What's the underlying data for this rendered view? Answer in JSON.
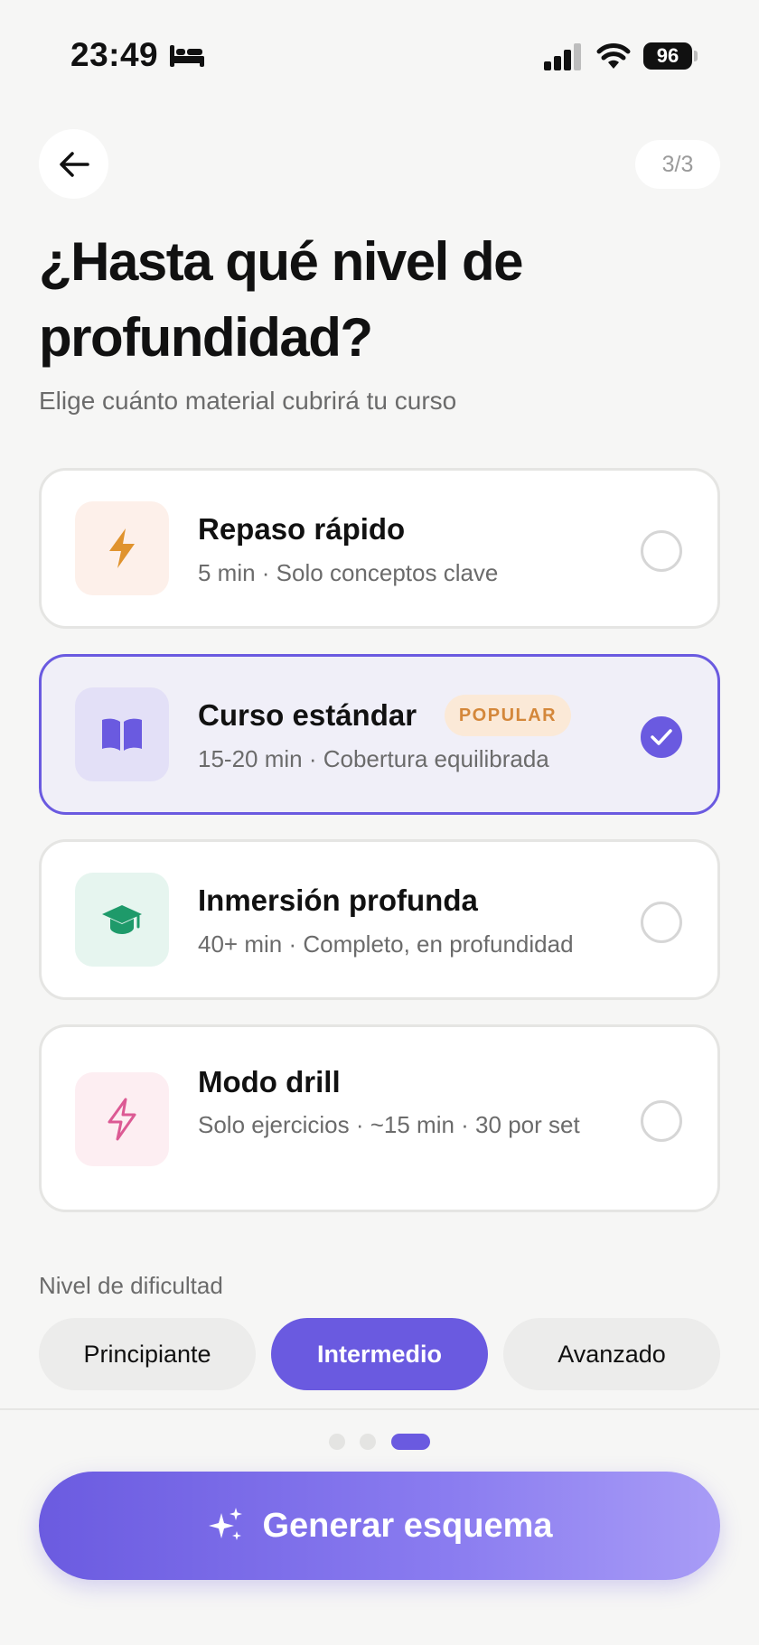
{
  "status_bar": {
    "time": "23:49",
    "battery": "96"
  },
  "header": {
    "step": "3/3"
  },
  "title": "¿Hasta qué nivel de profundidad?",
  "subtitle": "Elige cuánto material cubrirá tu curso",
  "options": [
    {
      "title": "Repaso rápido",
      "desc": "5 min · Solo conceptos clave",
      "icon": "lightning-icon",
      "selected": false
    },
    {
      "title": "Curso estándar",
      "desc": "15-20 min · Cobertura equilibrada",
      "icon": "book-icon",
      "badge": "POPULAR",
      "selected": true
    },
    {
      "title": "Inmersión profunda",
      "desc": "40+ min · Completo, en profundidad",
      "icon": "graduation-cap-icon",
      "selected": false
    },
    {
      "title": "Modo drill",
      "desc": "Solo ejercicios · ~15 min · 30 por set",
      "icon": "lightning-outline-icon",
      "selected": false
    }
  ],
  "difficulty": {
    "label": "Nivel de dificultad",
    "options": [
      "Principiante",
      "Intermedio",
      "Avanzado"
    ],
    "selected": "Intermedio"
  },
  "pager": {
    "total": 3,
    "current": 3
  },
  "cta": {
    "label": "Generar esquema",
    "icon": "sparkles-icon"
  },
  "colors": {
    "accent": "#6a5ae0",
    "background": "#f6f6f5",
    "popular_badge_bg": "#fbe9d7",
    "popular_badge_text": "#d4873a"
  }
}
